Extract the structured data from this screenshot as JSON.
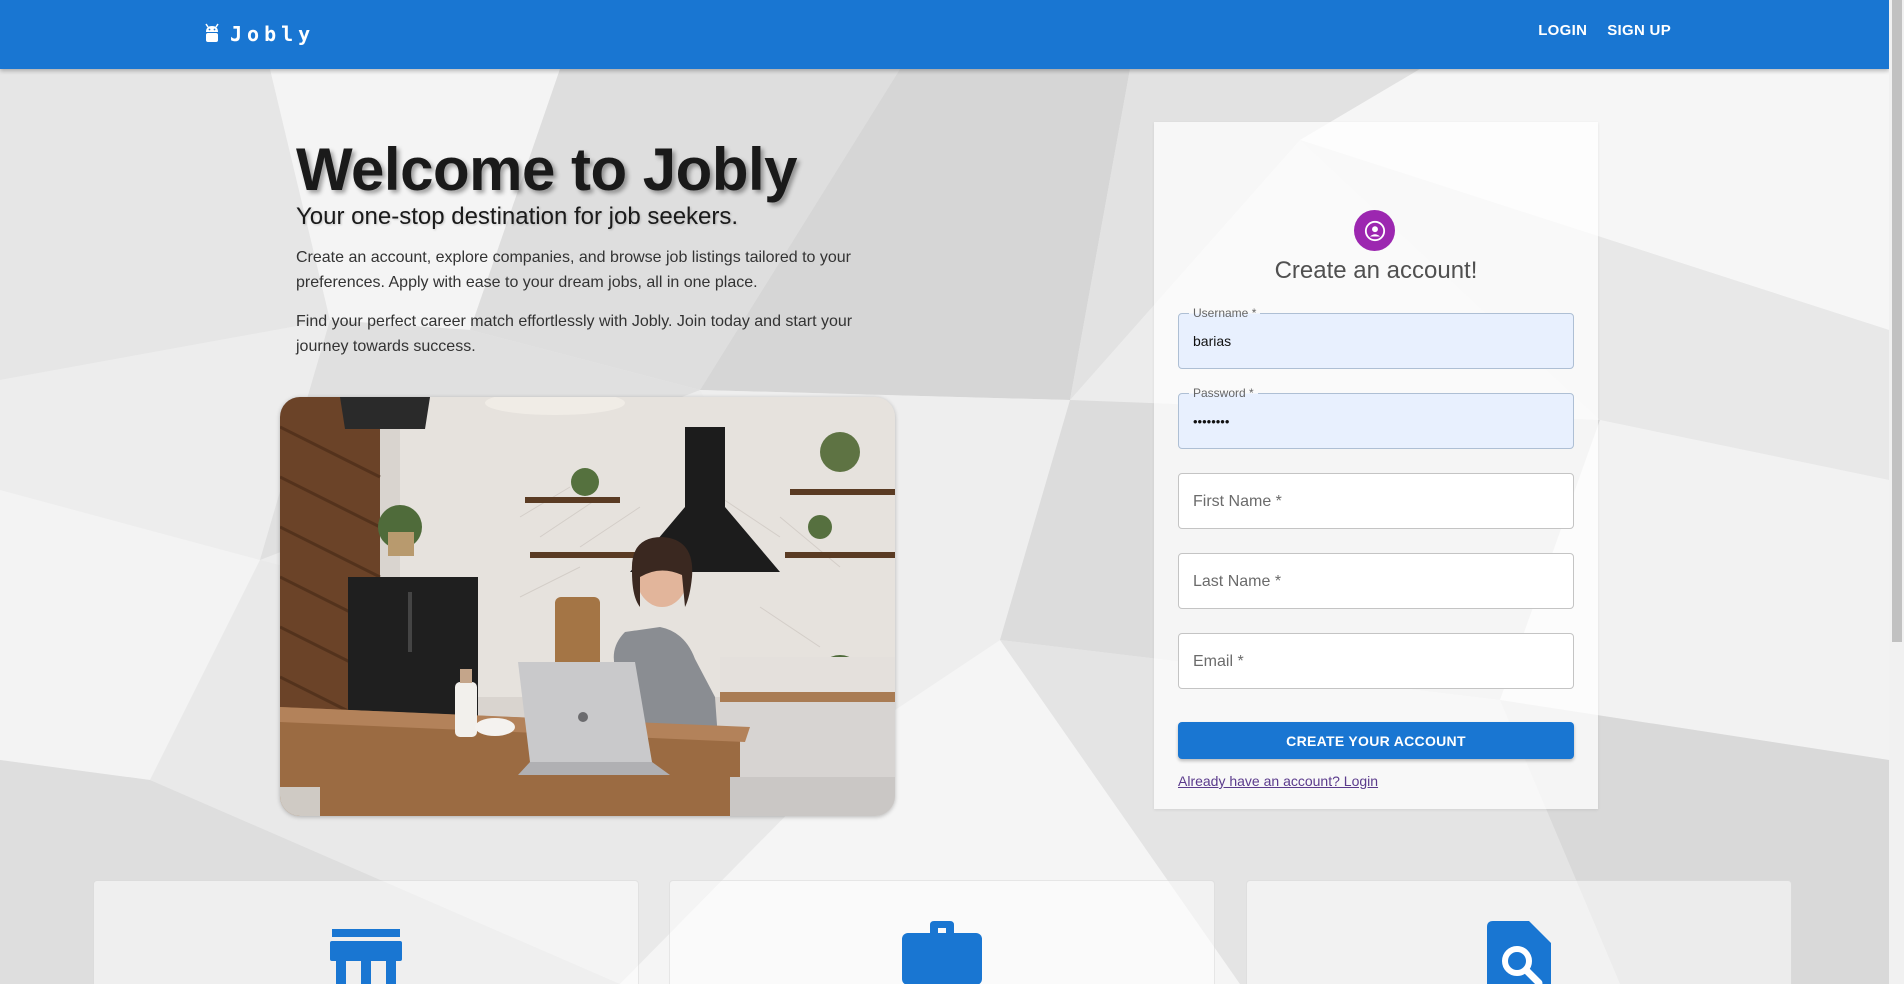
{
  "app": {
    "name": "Jobly",
    "logo_icon": "android-icon"
  },
  "nav": {
    "login": "LOGIN",
    "signup": "SIGN UP"
  },
  "hero": {
    "title": "Welcome to Jobly",
    "subtitle": "Your one-stop destination for job seekers.",
    "paragraph1": "Create an account, explore companies, and browse job listings tailored to your preferences. Apply with ease to your dream jobs, all in one place.",
    "paragraph2": "Find your perfect career match effortlessly with Jobly. Join today and start your journey towards success."
  },
  "signup_form": {
    "icon": "account-circle-icon",
    "title": "Create an account!",
    "username": {
      "label": "Username *",
      "value": "barias"
    },
    "password": {
      "label": "Password *",
      "value": "••••••••"
    },
    "first_name": {
      "placeholder": "First Name *"
    },
    "last_name": {
      "placeholder": "Last Name *"
    },
    "email": {
      "placeholder": "Email *"
    },
    "submit_label": "CREATE YOUR ACCOUNT",
    "login_link": "Already have an account? Login"
  },
  "features": [
    {
      "icon": "storefront-icon"
    },
    {
      "icon": "briefcase-icon"
    },
    {
      "icon": "document-search-icon"
    }
  ],
  "colors": {
    "primary": "#1976d2",
    "avatar": "#9c27b0",
    "link": "#5b3b8c"
  }
}
